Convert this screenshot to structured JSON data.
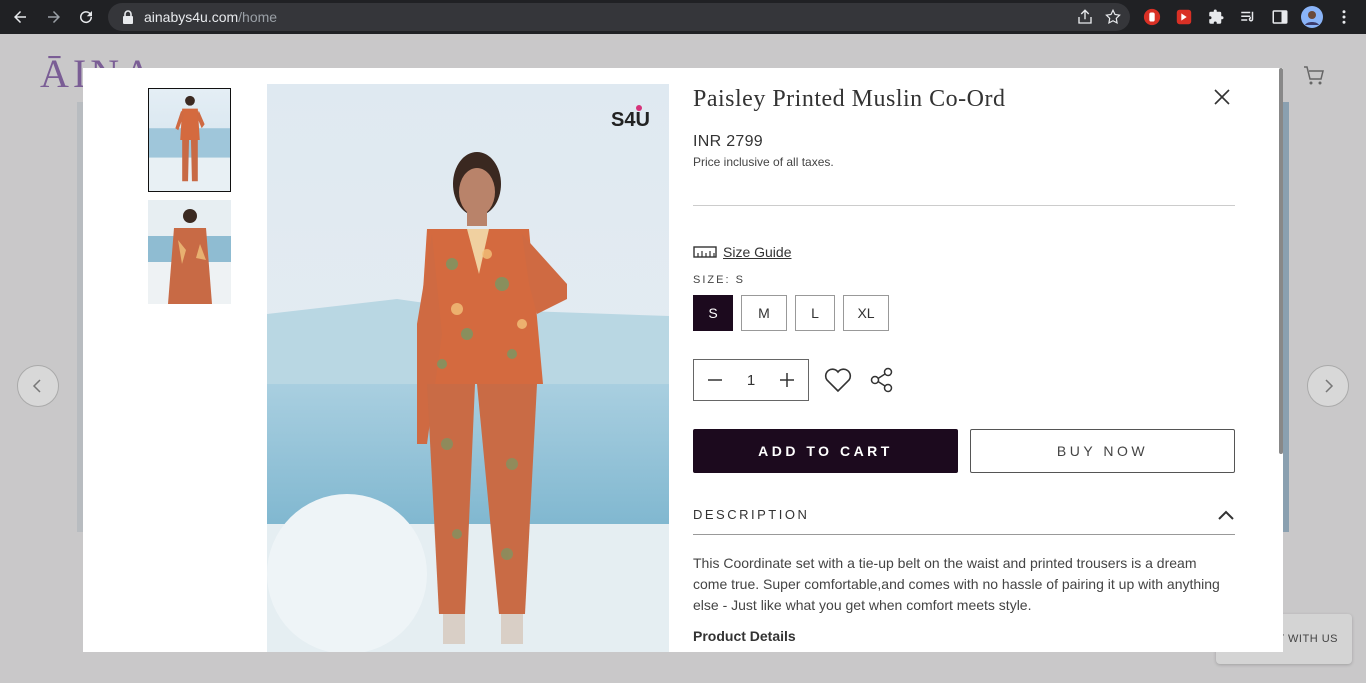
{
  "browser": {
    "url_domain": "ainabys4u.com",
    "url_path": "/home"
  },
  "background": {
    "logo": "ĀINA",
    "chat_label": "AT WITH US"
  },
  "product": {
    "title": "Paisley Printed Muslin Co-Ord",
    "price": "INR 2799",
    "tax_note": "Price inclusive of all taxes.",
    "size_guide_label": "Size Guide",
    "size_label": "SIZE:",
    "selected_size": "S",
    "sizes": [
      "S",
      "M",
      "L",
      "XL"
    ],
    "quantity": "1",
    "add_to_cart": "ADD TO CART",
    "buy_now": "BUY NOW",
    "description_title": "DESCRIPTION",
    "description": "This Coordinate set with a tie-up belt on the waist and printed trousers is a dream come true. Super comfortable,and comes with no hassle of pairing it up with anything else - Just like what you get when comfort meets style.",
    "product_details_heading": "Product Details",
    "brand_logo": "S4U"
  },
  "colors": {
    "primary_dark": "#1c0a1e",
    "outfit": "#d46a3f"
  }
}
